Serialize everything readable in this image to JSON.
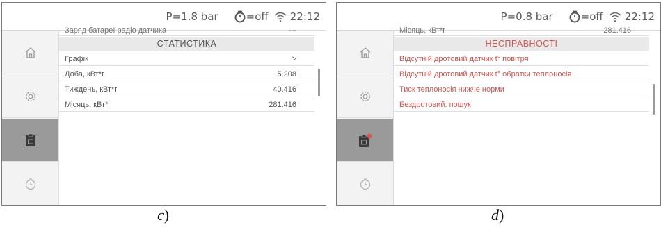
{
  "panels": [
    {
      "status": {
        "pressure": "P=1.8 bar",
        "timer": "=off",
        "time": "22:12"
      },
      "content": {
        "cut_row": {
          "label": "Заряд батареї радіо датчика",
          "value": "---"
        },
        "section_title": "СТАТИСТИКА",
        "rows": [
          {
            "label": "Графік",
            "value": ">"
          },
          {
            "label": "Доба, кВт*г",
            "value": "5.208"
          },
          {
            "label": "Тиждень, кВт*г",
            "value": "40.416"
          },
          {
            "label": "Місяць, кВт*г",
            "value": "281.416"
          }
        ]
      },
      "caption": {
        "letter": "c",
        "paren": ")"
      }
    },
    {
      "status": {
        "pressure": "P=0.8 bar",
        "timer": "=off",
        "time": "22:12"
      },
      "content": {
        "cut_row": {
          "label": "Місяць, кВт*г",
          "value": "281.416"
        },
        "section_title": "НЕСПРАВНОСТІ",
        "faults": [
          "Відсутній дротовий датчик t° повітря",
          "Відсутній дротовий датчик t° обратки теплоносія",
          "Тиск теплоносія нижче норми",
          "Бездротовий: пошук"
        ]
      },
      "caption": {
        "letter": "d",
        "paren": ")"
      }
    }
  ],
  "sidebar_icons": [
    "home-icon",
    "gear-icon",
    "clipboard-icon",
    "clock-icon"
  ],
  "colors": {
    "fault_red": "#d9534f",
    "active_tab": "#9a9a9a",
    "section_bg": "#e9e9e9"
  }
}
